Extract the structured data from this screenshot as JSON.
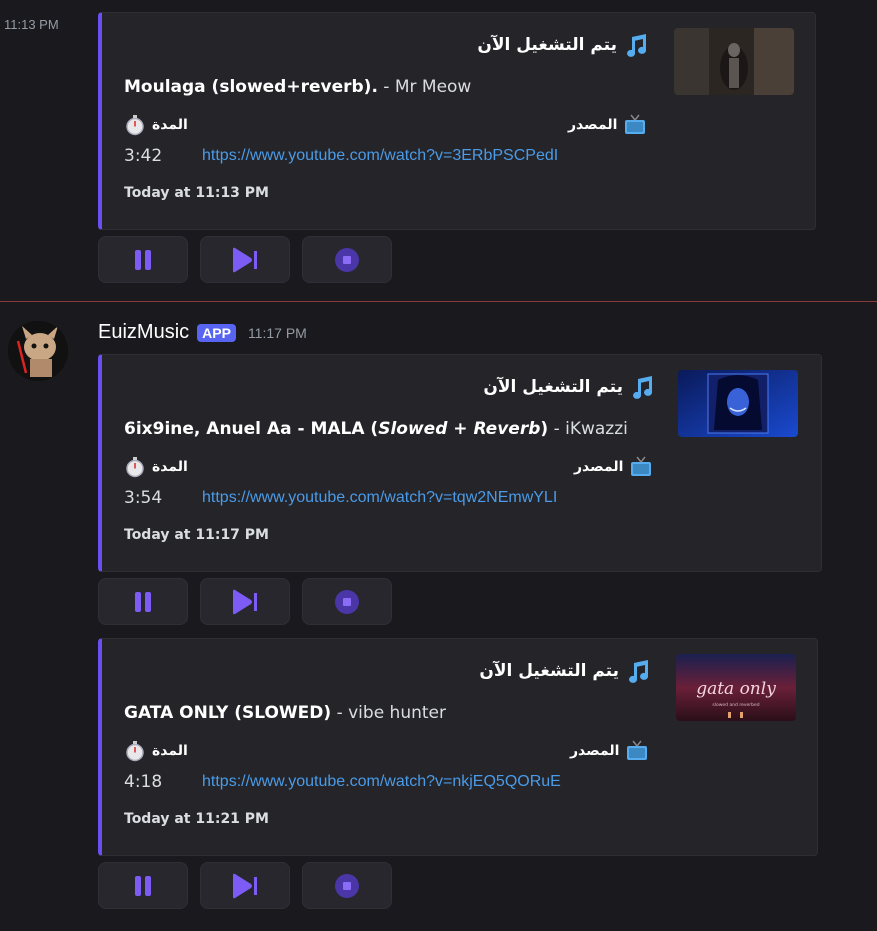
{
  "first_message": {
    "side_timestamp": "11:13 PM"
  },
  "author": {
    "name": "EuizMusic",
    "badge": "APP",
    "timestamp": "11:17 PM"
  },
  "embeds": [
    {
      "title": "يتم التشغيل الآن",
      "track_bold": "Moulaga (slowed+reverb).",
      "track_italic": "",
      "track_bold_after": "",
      "track_rest": " - Mr Meow",
      "source_label": "المصدر",
      "duration_label": "المدة",
      "duration": "3:42",
      "url": "https://www.youtube.com/watch?v=3ERbPSCPedI",
      "footer": "Today at 11:13 PM",
      "thumb_icon": "thumbnail-image"
    },
    {
      "title": "يتم التشغيل الآن",
      "track_bold": "6ix9ine, Anuel Aa - MALA (",
      "track_italic": "Slowed + Reverb",
      "track_bold_after": ")",
      "track_rest": " - iKwazzi",
      "source_label": "المصدر",
      "duration_label": "المدة",
      "duration": "3:54",
      "url": "https://www.youtube.com/watch?v=tqw2NEmwYLI",
      "footer": "Today at 11:17 PM",
      "thumb_icon": "thumbnail-image"
    },
    {
      "title": "يتم التشغيل الآن",
      "track_bold": "GATA ONLY (SLOWED)",
      "track_italic": "",
      "track_bold_after": "",
      "track_rest": " - vibe hunter",
      "source_label": "المصدر",
      "duration_label": "المدة",
      "duration": "4:18",
      "url": "https://www.youtube.com/watch?v=nkjEQ5QORuE",
      "footer": "Today at 11:21 PM",
      "thumb_text": "gata only",
      "thumb_small": "slowed and reverbed"
    }
  ],
  "controls": [
    "pause-icon",
    "skip-icon",
    "stop-icon"
  ],
  "colors": {
    "accent": "#6b4ff0",
    "link": "#4a9be8",
    "badge": "#5865f2",
    "button_icon": "#7c5cf5"
  }
}
